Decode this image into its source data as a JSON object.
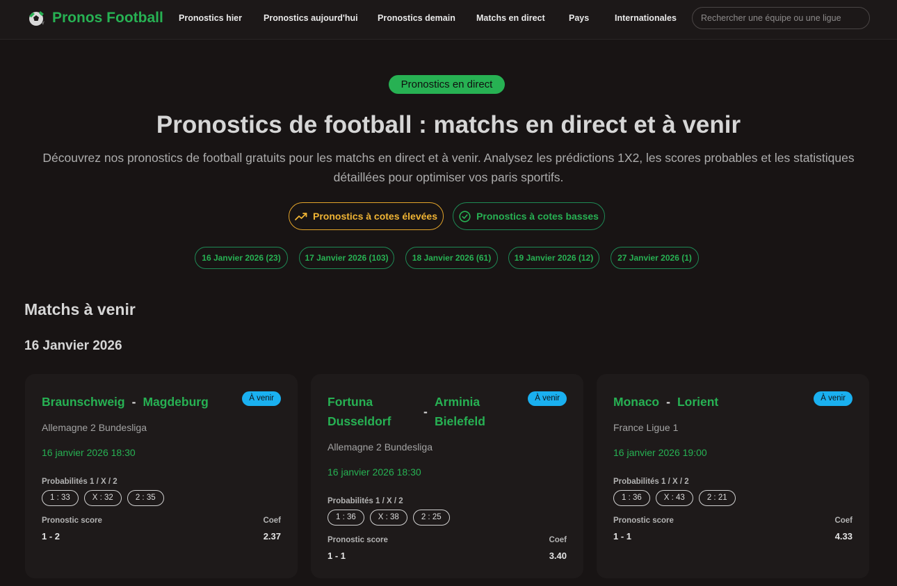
{
  "header": {
    "brand": "Pronos Football",
    "nav": [
      "Pronostics hier",
      "Pronostics aujourd'hui",
      "Pronostics demain",
      "Matchs en direct",
      "Pays",
      "Internationales"
    ],
    "search_placeholder": "Rechercher une équipe ou une ligue"
  },
  "hero": {
    "pill": "Pronostics en direct",
    "title": "Pronostics de football : matchs en direct et à venir",
    "description_line1": "Découvrez nos pronostics de football gratuits pour les matchs en direct et à venir. Analysez les prédictions 1X2, les scores probables et les statistiques",
    "description_line2": "détaillées pour optimiser vos paris sportifs.",
    "odds_high": "Pronostics à cotes élevées",
    "odds_low": "Pronostics à cotes basses",
    "dates": [
      "16 Janvier 2026 (23)",
      "17 Janvier 2026 (103)",
      "18 Janvier 2026 (61)",
      "19 Janvier 2026 (12)",
      "27 Janvier 2026 (1)"
    ]
  },
  "section": {
    "title": "Matchs à venir",
    "day": "16 Janvier 2026"
  },
  "labels": {
    "probabilities": "Probabilités 1 / X / 2",
    "score": "Pronostic score",
    "coef": "Coef",
    "separator": "-"
  },
  "matches": [
    {
      "home": "Braunschweig",
      "away": "Magdeburg",
      "status": "À venir",
      "league": "Allemagne 2 Bundesliga",
      "kickoff": "16 janvier 2026 18:30",
      "p1": "1 : 33",
      "px": "X : 32",
      "p2": "2 : 35",
      "score": "1 - 2",
      "coef": "2.37"
    },
    {
      "home": "Fortuna Dusseldorf",
      "away": "Arminia Bielefeld",
      "status": "À venir",
      "league": "Allemagne 2 Bundesliga",
      "kickoff": "16 janvier 2026 18:30",
      "p1": "1 : 36",
      "px": "X : 38",
      "p2": "2 : 25",
      "score": "1 - 1",
      "coef": "3.40"
    },
    {
      "home": "Monaco",
      "away": "Lorient",
      "status": "À venir",
      "league": "France Ligue 1",
      "kickoff": "16 janvier 2026 19:00",
      "p1": "1 : 36",
      "px": "X : 43",
      "p2": "2 : 21",
      "score": "1 - 1",
      "coef": "4.33"
    }
  ],
  "colors": {
    "accent_green": "#27b153",
    "accent_orange": "#f0b434",
    "status_blue": "#1ab0f0",
    "background": "#181414",
    "card": "#1e1a1a"
  },
  "icons": [
    "football-logo-icon",
    "trending-up-icon",
    "check-circle-icon"
  ]
}
